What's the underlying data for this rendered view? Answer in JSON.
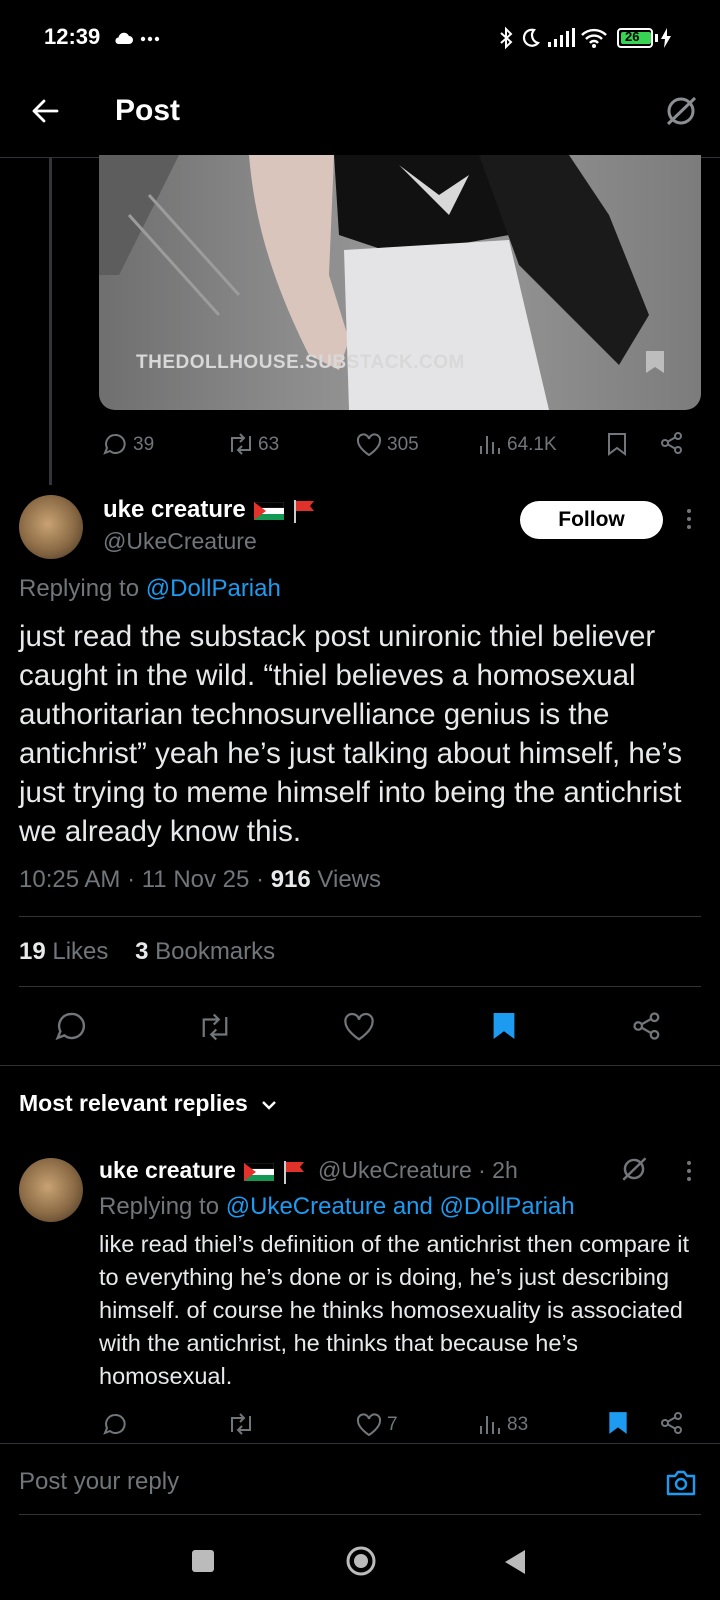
{
  "status_bar": {
    "time": "12:39",
    "battery": "26"
  },
  "header": {
    "title": "Post"
  },
  "media": {
    "caption": "THEDOLLHOUSE.SUBSTACK.COM"
  },
  "parent_actions": {
    "replies": "39",
    "reposts": "63",
    "likes": "305",
    "views": "64.1K"
  },
  "tweet": {
    "author_name": "uke creature",
    "author_handle": "@UkeCreature",
    "follow_label": "Follow",
    "replying_prefix": "Replying to",
    "replying_to": "@DollPariah",
    "text": "just read the substack post unironic thiel believer caught in the wild. “thiel believes a homosexual authoritarian technosurvelliance genius is the antichrist” yeah he’s just talking about himself, he’s just trying to meme himself into being the antichrist we already know this.",
    "time": "10:25 AM · 11 Nov 25 ·",
    "views_count": "916",
    "views_label": "Views",
    "likes_count": "19",
    "likes_label": "Likes",
    "bookmarks_count": "3",
    "bookmarks_label": "Bookmarks"
  },
  "replies_section": {
    "label": "Most relevant replies"
  },
  "reply": {
    "author_name": "uke creature",
    "meta": "@UkeCreature · 2h",
    "replying_prefix": "Replying to",
    "replying_to": "@UkeCreature and @DollPariah",
    "text": "like read thiel’s definition of the antichrist then compare it to everything he’s done or is doing, he’s just describing himself. of course he thinks homosexuality is associated with the antichrist, he thinks that because he’s homosexual.",
    "likes": "7",
    "views": "83"
  },
  "composer": {
    "placeholder": "Post your reply"
  },
  "colors": {
    "accent": "#1d9bf0",
    "secondary_text": "#71767b",
    "divider": "#2f3336"
  }
}
